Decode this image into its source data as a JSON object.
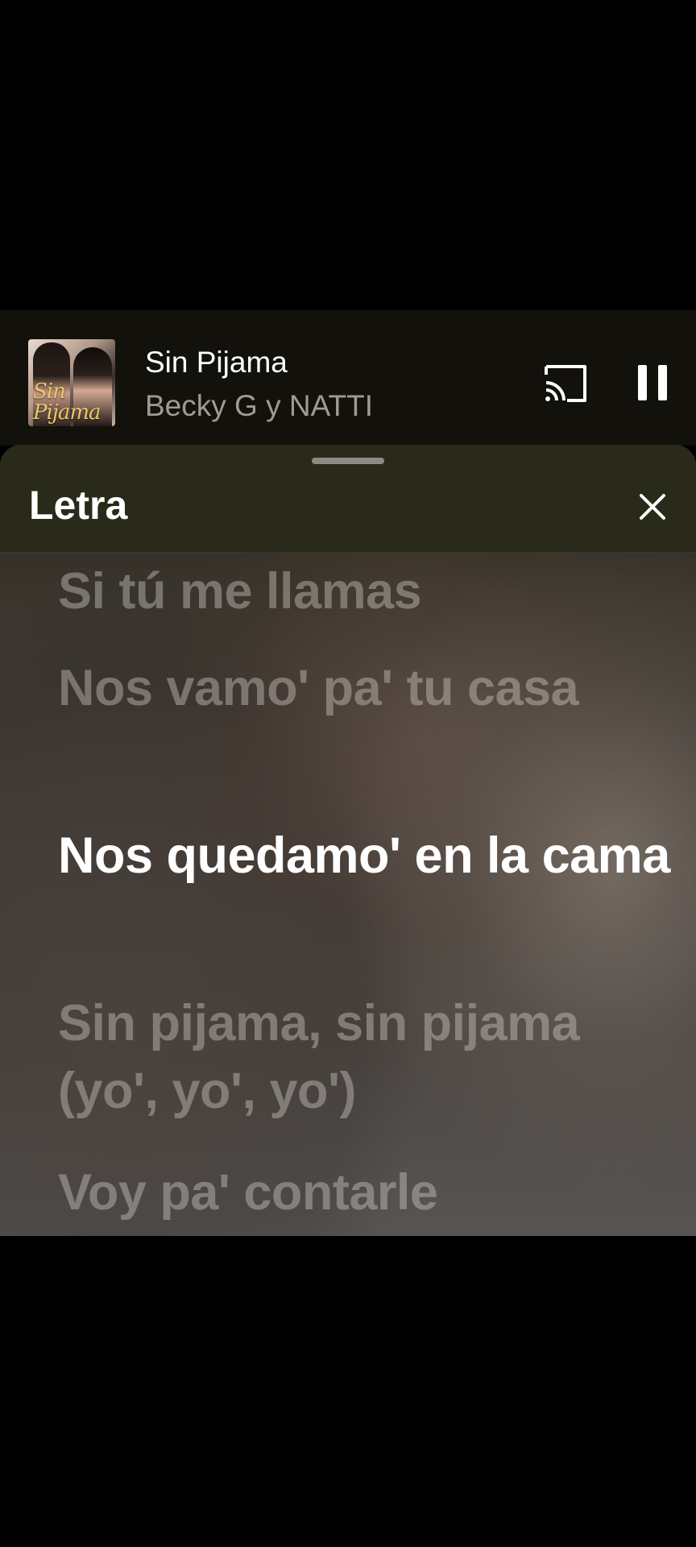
{
  "mini_player": {
    "title": "Sin Pijama",
    "artist": "Becky G y NATTI",
    "album_art_text": "Sin Pijama",
    "cast_icon": "cast-icon",
    "pause_icon": "pause-icon"
  },
  "lyrics": {
    "header_title": "Letra",
    "close_icon": "close-icon",
    "lines": [
      {
        "text": "Si tú me llamas",
        "active": false
      },
      {
        "text": "Nos vamo' pa' tu casa",
        "active": false
      },
      {
        "text": "Nos quedamo' en la cama",
        "active": true
      },
      {
        "text": "Sin pijama, sin pijama (yo', yo', yo')",
        "active": false
      },
      {
        "text": "Voy pa' contarle",
        "active": false
      }
    ]
  },
  "colors": {
    "mini_player_bg": "#12110b",
    "lyrics_header_bg": "#2a2a1a",
    "active_lyric": "#ffffff",
    "inactive_lyric": "#8f8a84",
    "artist_text": "#9e9b93"
  }
}
